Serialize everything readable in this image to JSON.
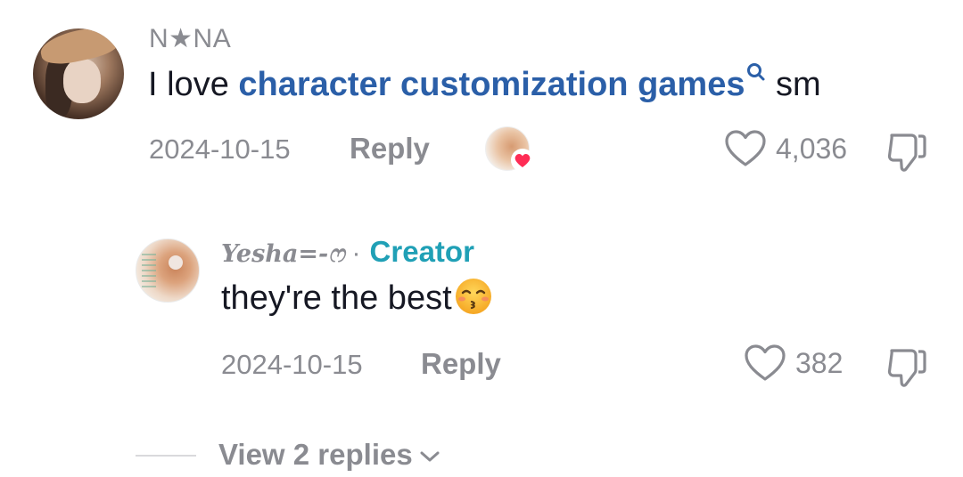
{
  "comment": {
    "username": "N★NA",
    "text_before": "I love ",
    "keyword_link": "character customization games",
    "text_after": " sm",
    "date": "2024-10-15",
    "reply_label": "Reply",
    "like_count": "4,036",
    "creator_liked": true
  },
  "reply": {
    "username": "Yesha=-ෆ",
    "separator": "·",
    "badge": "Creator",
    "text": "they're the best",
    "emoji": "kissing-face-with-closed-eyes",
    "date": "2024-10-15",
    "reply_label": "Reply",
    "like_count": "382"
  },
  "view_replies_label": "View 2 replies",
  "colors": {
    "link_blue": "#2b5fa8",
    "creator_teal": "#20a0b6",
    "muted_gray": "#8a8b91",
    "heart_red": "#fe2c55"
  }
}
